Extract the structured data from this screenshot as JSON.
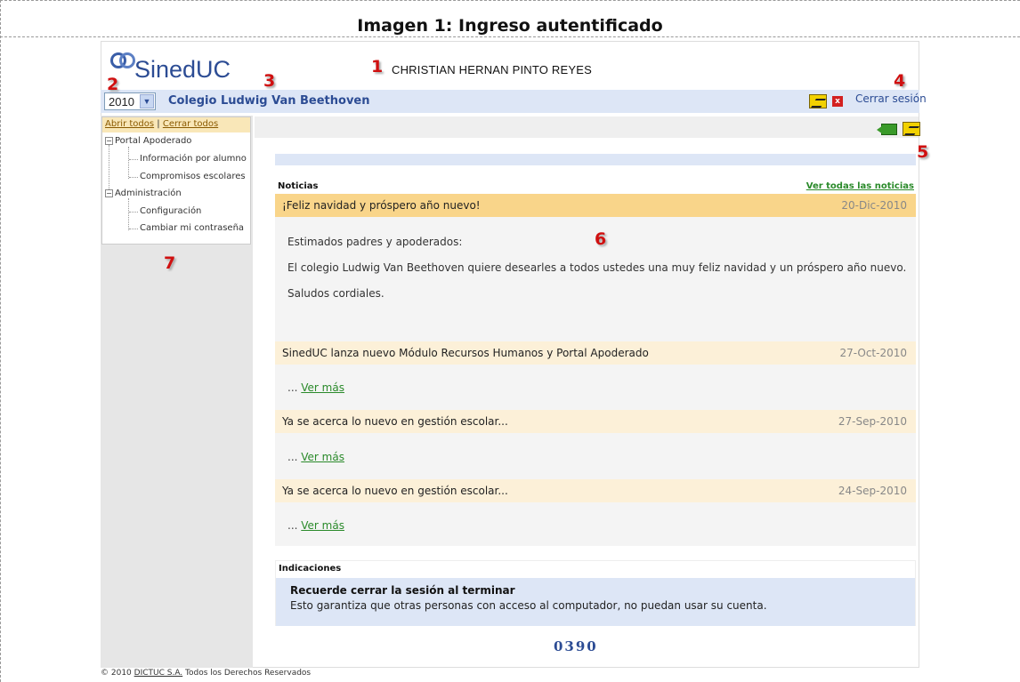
{
  "doc_title": "Imagen 1: Ingreso autentificado",
  "logo_text": "SinedUC",
  "user_name": "CHRISTIAN HERNAN PINTO REYES",
  "year_select": {
    "value": "2010"
  },
  "school_name": "Colegio Ludwig Van Beethoven",
  "logout_label": "Cerrar sesión",
  "tree": {
    "open_all": "Abrir todos",
    "separator": "|",
    "close_all": "Cerrar todos",
    "groups": [
      {
        "label": "Portal Apoderado",
        "items": [
          "Información por alumno",
          "Compromisos escolares"
        ]
      },
      {
        "label": "Administración",
        "items": [
          "Configuración",
          "Cambiar mi contraseña"
        ]
      }
    ]
  },
  "news": {
    "heading": "Noticias",
    "see_all": "Ver todas las noticias",
    "items": [
      {
        "title": "¡Feliz navidad y próspero año nuevo!",
        "date": "20-Dic-2010",
        "body": [
          "Estimados padres y apoderados:",
          "El colegio Ludwig Van Beethoven quiere desearles a todos ustedes una muy feliz navidad y un próspero año nuevo.",
          "Saludos cordiales."
        ]
      },
      {
        "title": "SinedUC lanza nuevo Módulo Recursos Humanos y Portal Apoderado",
        "date": "27-Oct-2010",
        "more_prefix": "... ",
        "more": "Ver más"
      },
      {
        "title": "Ya se acerca lo nuevo en gestión escolar...",
        "date": "27-Sep-2010",
        "more_prefix": "... ",
        "more": "Ver más"
      },
      {
        "title": "Ya se acerca lo nuevo en gestión escolar...",
        "date": "24-Sep-2010",
        "more_prefix": "... ",
        "more": "Ver más"
      }
    ]
  },
  "indicaciones": {
    "heading": "Indicaciones",
    "title": "Recuerde cerrar la sesión al terminar",
    "text": "Esto garantiza que otras personas con acceso al computador, no puedan usar su cuenta."
  },
  "counter": "0390",
  "footer": {
    "prefix": "© 2010 ",
    "link": "DICTUC S.A.",
    "suffix": " Todos los Derechos Reservados"
  },
  "annotations": [
    "1",
    "2",
    "3",
    "4",
    "5",
    "6",
    "7"
  ],
  "colors": {
    "accent": "#2c4c94",
    "highlight_row": "#f9d58a",
    "annotation": "#d01010",
    "link_green": "#2a8a2a"
  },
  "icons": [
    "logo-mark",
    "key-icon",
    "close-icon",
    "back-icon",
    "expand-collapse-icon"
  ]
}
